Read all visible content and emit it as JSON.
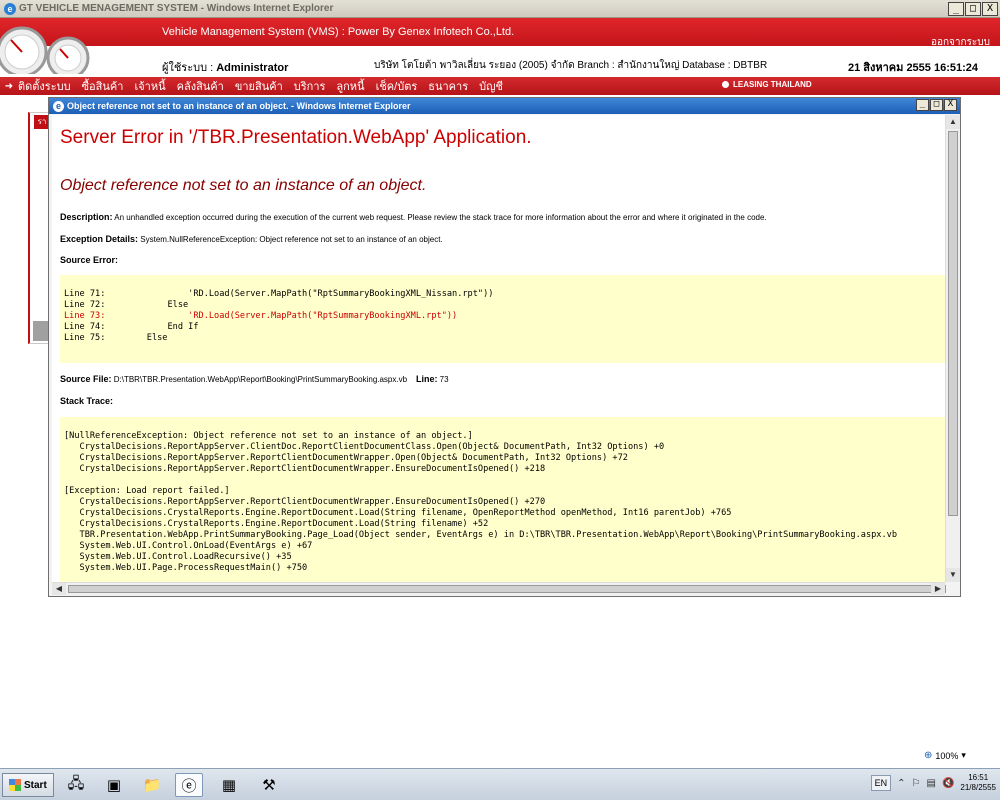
{
  "window": {
    "title": "GT VEHICLE MENAGEMENT SYSTEM - Windows Internet Explorer",
    "minimize": "_",
    "maximize": "□",
    "close": "X"
  },
  "header": {
    "title": "Vehicle Management System (VMS)  : Power By Genex Infotech Co.,Ltd.",
    "logout": "ออกจากระบบ",
    "user_label": "ผู้ใช้ระบบ : ",
    "user_name": "Administrator",
    "branch_info": "บริษัท โตโยต้า พาวิลเลี่ยน ระยอง (2005) จำกัด Branch : สำนักงานใหญ่ Database : DBTBR",
    "datetime": "21 สิงหาคม 2555 16:51:24"
  },
  "nav": {
    "arrow": "➜",
    "items": [
      "ติดตั้งระบบ",
      "ซื้อสินค้า",
      "เจ้าหนี้",
      "คลังสินค้า",
      "ขายสินค้า",
      "บริการ",
      "ลูกหนี้",
      "เช็ค/บัตร",
      "ธนาคาร",
      "บัญชี"
    ],
    "leasing_badge": "LEASING THAILAND"
  },
  "bg_panel": {
    "tag": "รา"
  },
  "popup": {
    "title": "Object reference not set to an instance of an object. - Windows Internet Explorer",
    "error_heading": "Server Error in '/TBR.Presentation.WebApp' Application.",
    "error_subheading": "Object reference not set to an instance of an object.",
    "description_label": "Description:",
    "description_text": " An unhandled exception occurred during the execution of the current web request. Please review the stack trace for more information about the error and where it originated in the code.",
    "exception_label": "Exception Details:",
    "exception_text": " System.NullReferenceException: Object reference not set to an instance of an object.",
    "source_error_label": "Source Error:",
    "source_lines": [
      {
        "text": "Line 71:                'RD.Load(Server.MapPath(\"RptSummaryBookingXML_Nissan.rpt\"))",
        "error": false
      },
      {
        "text": "Line 72:            Else",
        "error": false
      },
      {
        "text": "Line 73:                'RD.Load(Server.MapPath(\"RptSummaryBookingXML.rpt\"))",
        "error": true
      },
      {
        "text": "Line 74:            End If",
        "error": false
      },
      {
        "text": "Line 75:        Else",
        "error": false
      }
    ],
    "source_file_label": "Source File:",
    "source_file": " D:\\TBR\\TBR.Presentation.WebApp\\Report\\Booking\\PrintSummaryBooking.aspx.vb",
    "line_label": "Line:",
    "line_number": " 73",
    "stack_trace_label": "Stack Trace:",
    "stack_trace": "[NullReferenceException: Object reference not set to an instance of an object.]\n   CrystalDecisions.ReportAppServer.ClientDoc.ReportClientDocumentClass.Open(Object& DocumentPath, Int32 Options) +0\n   CrystalDecisions.ReportAppServer.ReportClientDocumentWrapper.Open(Object& DocumentPath, Int32 Options) +72\n   CrystalDecisions.ReportAppServer.ReportClientDocumentWrapper.EnsureDocumentIsOpened() +218\n\n[Exception: Load report failed.]\n   CrystalDecisions.ReportAppServer.ReportClientDocumentWrapper.EnsureDocumentIsOpened() +270\n   CrystalDecisions.CrystalReports.Engine.ReportDocument.Load(String filename, OpenReportMethod openMethod, Int16 parentJob) +765\n   CrystalDecisions.CrystalReports.Engine.ReportDocument.Load(String filename) +52\n   TBR.Presentation.WebApp.PrintSummaryBooking.Page_Load(Object sender, EventArgs e) in D:\\TBR\\TBR.Presentation.WebApp\\Report\\Booking\\PrintSummaryBooking.aspx.vb\n   System.Web.UI.Control.OnLoad(EventArgs e) +67\n   System.Web.UI.Control.LoadRecursive() +35\n   System.Web.UI.Page.ProcessRequestMain() +750"
  },
  "statusbar": {
    "zoom": "100%"
  },
  "taskbar": {
    "start": "Start",
    "lang": "EN",
    "time": "16:51",
    "date": "21/8/2555"
  }
}
